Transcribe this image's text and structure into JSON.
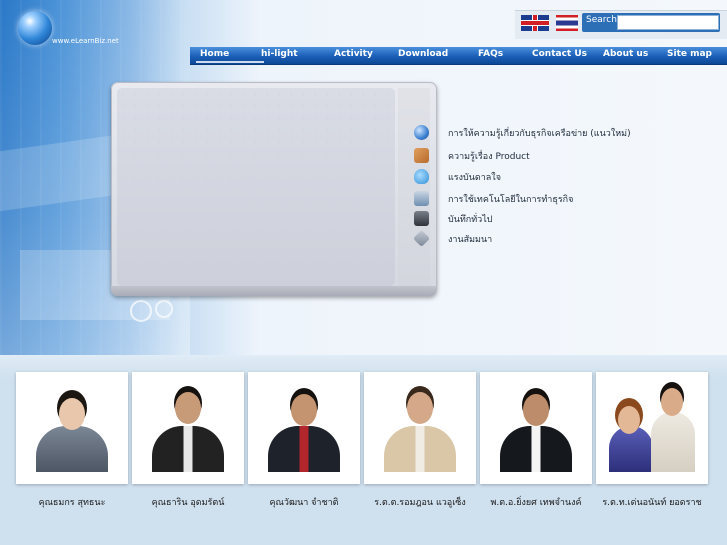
{
  "site": {
    "logo_text": "www.eLearnBiz.net"
  },
  "search": {
    "label": "Search",
    "placeholder": ""
  },
  "flags": [
    {
      "name": "english-flag-icon"
    },
    {
      "name": "thai-flag-icon"
    }
  ],
  "nav": {
    "items": [
      "Home",
      "hi-light",
      "Activity",
      "Download",
      "FAQs",
      "Contact Us",
      "About us",
      "Site map"
    ]
  },
  "menu": {
    "items": [
      {
        "label": "การให้ความรู้เกี่ยวกับธุรกิจเครือข่าย (แนวใหม่)",
        "icon": "globe-icon",
        "color": "#3b7fd0"
      },
      {
        "label": "ความรู้เรื่อง Product",
        "icon": "box-icon",
        "color": "#b86a2b"
      },
      {
        "label": "แรงบันดาลใจ",
        "icon": "heart-icon",
        "color": "#2f8fd8"
      },
      {
        "label": "การใช้เทคโนโลยีในการทำธุรกิจ",
        "icon": "computer-icon",
        "color": "#6e8fb0"
      },
      {
        "label": "บันทึกทั่วไป",
        "icon": "camera-icon",
        "color": "#444a55"
      },
      {
        "label": "งานสัมมนา",
        "icon": "diamond-icon",
        "color": "#7d8796"
      }
    ]
  },
  "people": [
    {
      "name": "คุณธมกร สุทธนะ"
    },
    {
      "name": "คุณธาริน อุดมรัตน์"
    },
    {
      "name": "คุณวัฒนา จำชาติ"
    },
    {
      "name": "ร.ต.ต.รอมฎอน แวอูเซ็ง"
    },
    {
      "name": "พ.ต.อ.ยิ่งยศ เทพจำนงค์"
    },
    {
      "name": "ร.ต.ท.เด่นอนันท์ ยอดราช"
    }
  ],
  "colors": {
    "nav_bar": "#1b5fb8",
    "accent": "#2d6fb7",
    "panel": "#d5d8e0",
    "bottom_band": "#cfe0ef"
  }
}
